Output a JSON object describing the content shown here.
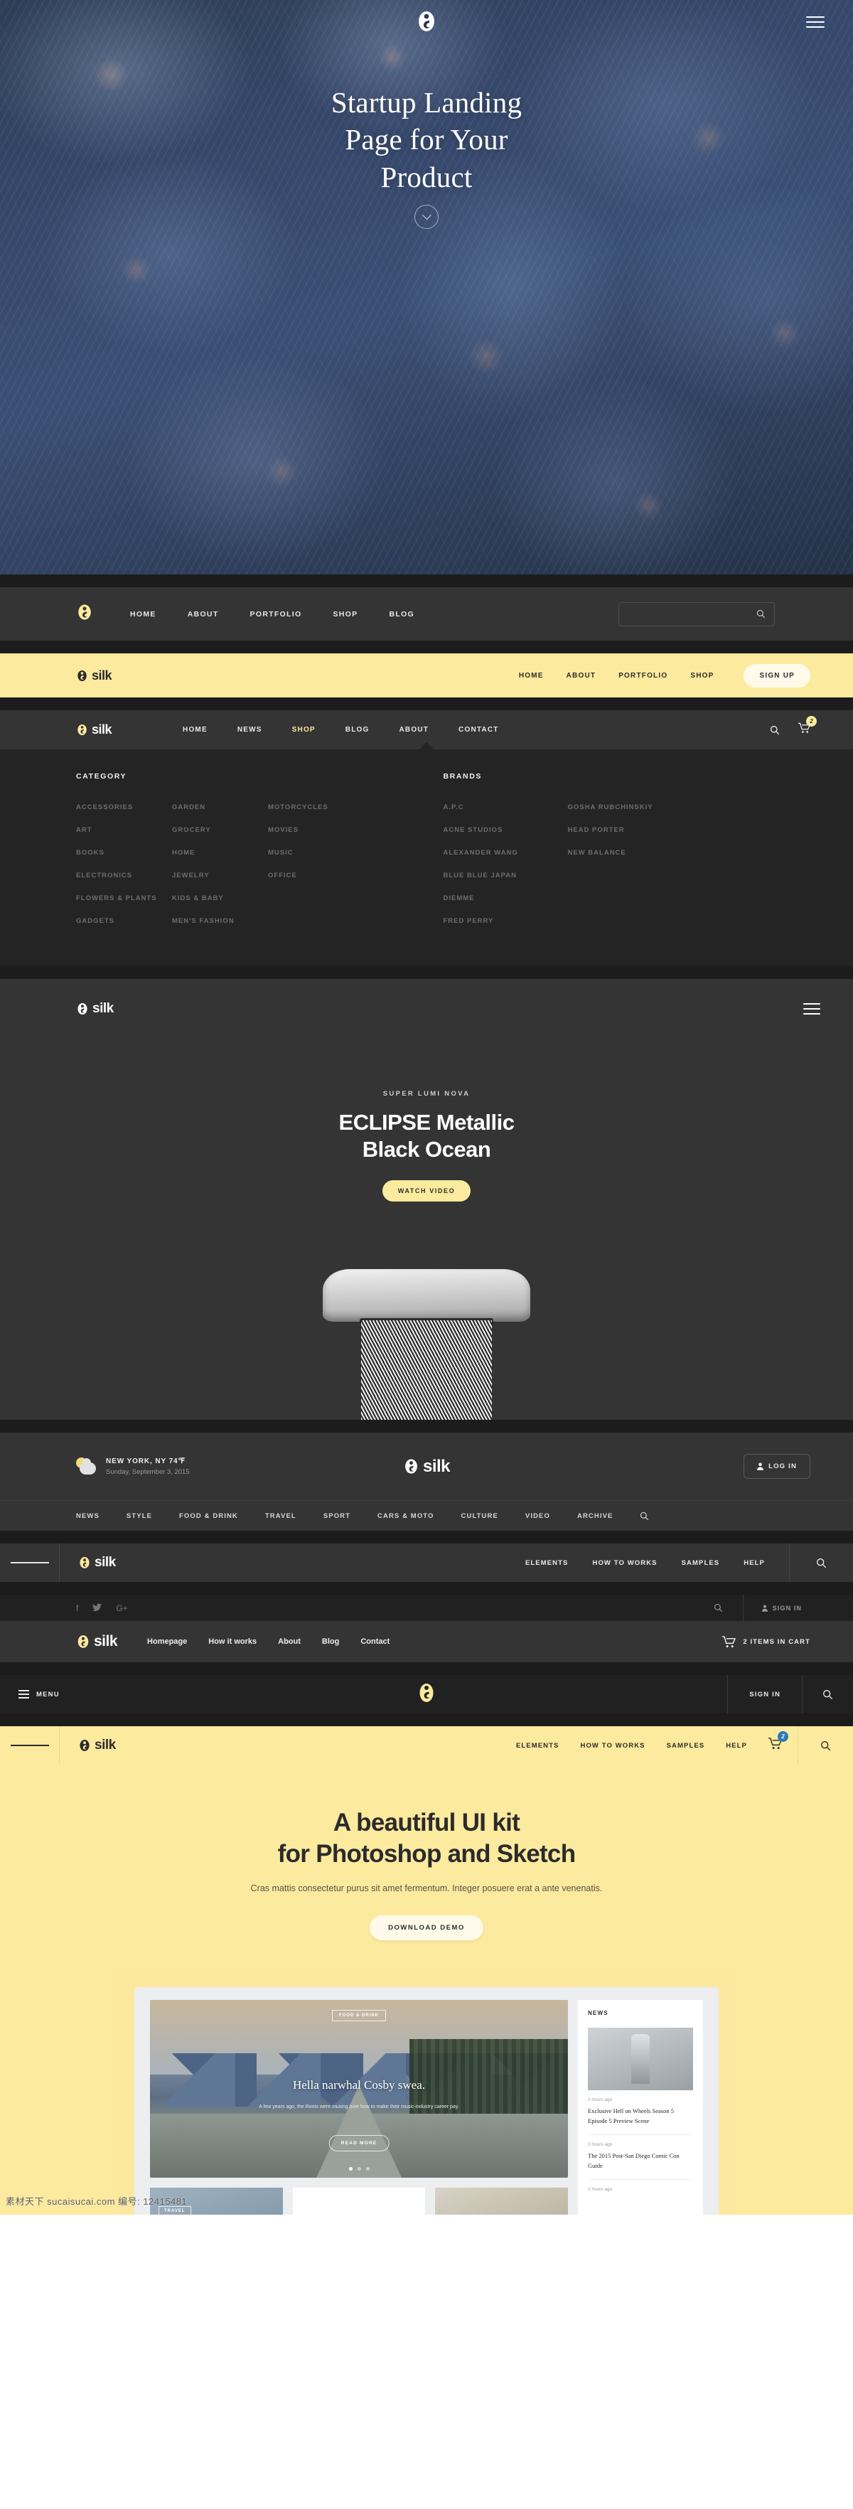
{
  "brand": {
    "name": "silk",
    "accent_yellow": "#fcea9e",
    "dark": "#343434",
    "darker": "#242424",
    "black": "#1c1c1c"
  },
  "hero": {
    "title_line1": "Startup Landing",
    "title_line2": "Page for Your",
    "title_line3": "Product",
    "logo_icon": "silk-mark-icon",
    "menu_icon": "hamburger-icon",
    "scroll_icon": "chevron-down-icon"
  },
  "nav_search": {
    "logo_icon": "silk-mark-icon",
    "links": [
      "HOME",
      "ABOUT",
      "PORTFOLIO",
      "SHOP",
      "BLOG"
    ],
    "search_placeholder": "",
    "search_icon": "search-icon"
  },
  "nav_yellow_signup": {
    "brand": "silk",
    "links": [
      "HOME",
      "ABOUT",
      "PORTFOLIO",
      "SHOP"
    ],
    "signup_label": "SIGN UP"
  },
  "mega_nav": {
    "brand": "silk",
    "links": [
      "HOME",
      "NEWS",
      "SHOP",
      "BLOG",
      "ABOUT",
      "CONTACT"
    ],
    "active": "SHOP",
    "search_icon": "search-icon",
    "cart_icon": "cart-icon",
    "cart_count": "2"
  },
  "mega_menu": {
    "category_heading": "CATEGORY",
    "brands_heading": "BRANDS",
    "category_col1": [
      "ACCESSORIES",
      "ART",
      "BOOKS",
      "ELECTRONICS",
      "FLOWERS & PLANTS",
      "GADGETS"
    ],
    "category_col2": [
      "GARDEN",
      "GROCERY",
      "HOME",
      "JEWELRY",
      "KIDS & BABY",
      "MEN'S FASHION"
    ],
    "category_col3": [
      "MOTORCYCLES",
      "MOVIES",
      "MUSIC",
      "OFFICE"
    ],
    "brands_col1": [
      "A.P.C",
      "ACNE STUDIOS",
      "ALEXANDER WANG",
      "BLUE BLUE JAPAN",
      "DIEMME",
      "FRED PERRY"
    ],
    "brands_col2": [
      "GOSHA RUBCHINSKIY",
      "HEAD PORTER",
      "NEW BALANCE"
    ]
  },
  "product": {
    "brand": "silk",
    "menu_icon": "hamburger-icon",
    "kicker": "SUPER LUMI NOVA",
    "title_line1": "ECLIPSE Metallic",
    "title_line2": "Black Ocean",
    "cta_label": "WATCH VIDEO",
    "image_name": "metal-mesh-watch"
  },
  "magazine": {
    "weather_icon": "sun-cloud-icon",
    "city_temp": "NEW YORK, NY  74℉",
    "date": "Sunday, September 3, 2015",
    "brand": "silk",
    "login_label": "LOG IN",
    "login_icon": "user-icon",
    "nav": [
      "NEWS",
      "STYLE",
      "FOOD & DRINK",
      "TRAVEL",
      "SPORT",
      "CARS & MOTO",
      "CULTURE",
      "VIDEO",
      "ARCHIVE"
    ],
    "search_icon": "search-icon"
  },
  "nav_elements_dark": {
    "menu_icon": "hamburger-icon",
    "brand": "silk",
    "links": [
      "ELEMENTS",
      "HOW TO WORKS",
      "SAMPLES",
      "HELP"
    ],
    "search_icon": "search-icon"
  },
  "nav_social": {
    "socials": [
      "facebook-icon",
      "twitter-icon",
      "google-plus-icon"
    ],
    "facebook_glyph": "f",
    "twitter_glyph": "🐦",
    "gplus_glyph": "G+",
    "search_icon": "search-icon",
    "signin_label": "SIGN IN",
    "signin_icon": "user-icon"
  },
  "nav_cart": {
    "brand": "silk",
    "links": [
      "Homepage",
      "How it works",
      "About",
      "Blog",
      "Contact"
    ],
    "cart_icon": "cart-icon",
    "cart_label": "2 ITEMS IN CART"
  },
  "nav_menu_centered": {
    "menu_label": "MENU",
    "menu_icon": "hamburger-icon",
    "logo_icon": "silk-mark-icon",
    "signin_label": "SIGN IN",
    "search_icon": "search-icon"
  },
  "nav_elements_yellow": {
    "menu_icon": "hamburger-icon",
    "brand": "silk",
    "links": [
      "ELEMENTS",
      "HOW TO WORKS",
      "SAMPLES",
      "HELP"
    ],
    "cart_icon": "cart-icon",
    "cart_count": "2",
    "search_icon": "search-icon"
  },
  "kit": {
    "title_line1": "A beautiful UI kit",
    "title_line2": "for Photoshop and Sketch",
    "subtitle": "Cras mattis consectetur purus sit amet fermentum. Integer posuere erat a ante venenatis.",
    "cta_label": "DOWNLOAD DEMO"
  },
  "mockup": {
    "hero_tag": "FOOD & DRINK",
    "hero_title": "Hella narwhal Cosby swea.",
    "hero_sub": "A few years ago, the Roots were musing over how to make their music-industry career pay.",
    "hero_btn": "READ MORE",
    "thumb_tag": "TRAVEL",
    "news_heading": "NEWS",
    "news_items": [
      {
        "time": "2 hours ago",
        "title": "Exclusive Hell on Wheels Season 5 Episode 5 Preview Scene"
      },
      {
        "time": "2 hours ago",
        "title": "The 2015 Post-San Diego Comic Con Guide"
      },
      {
        "time": "2 hours ago",
        "title": ""
      }
    ]
  },
  "watermark": {
    "text": "素材天下 sucaisucai.com  编号: 12415481"
  }
}
